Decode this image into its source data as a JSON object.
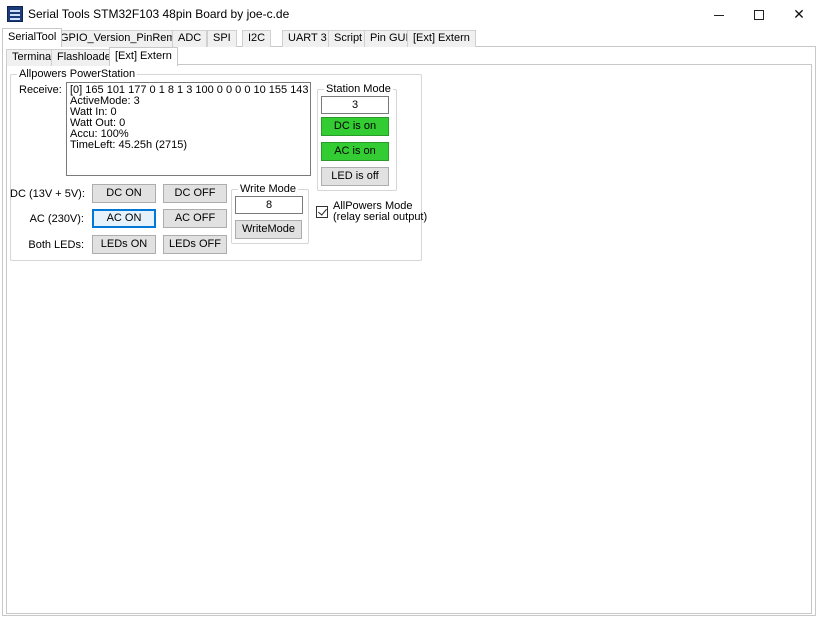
{
  "window": {
    "title": "Serial Tools STM32F103 48pin Board by joe-c.de",
    "controls": {
      "minimize": "",
      "maximize": "",
      "close": "✕"
    }
  },
  "top_tabs": [
    "SerialTool",
    "GPIO_Version_PinRemap",
    "ADC",
    "SPI",
    "I2C",
    "UART 3",
    "Script",
    "Pin GUI",
    "[Ext] Extern"
  ],
  "sub_tabs": [
    "Terminal",
    "Flashloader",
    "[Ext] Extern"
  ],
  "powerstation": {
    "group_title": "Allpowers PowerStation",
    "receive_label": "Receive:",
    "receive_lines": [
      "[0] 165 101 177 0 1 8 1 3 100 0 0 0 0 10 155 143",
      "ActiveMode: 3",
      "Watt In: 0",
      "Watt Out: 0",
      "Accu: 100%",
      "TimeLeft: 45.25h (2715)"
    ],
    "dc_label": "DC (13V + 5V):",
    "ac_label": "AC (230V):",
    "leds_label": "Both LEDs:",
    "dc_on": "DC ON",
    "dc_off": "DC OFF",
    "ac_on": "AC ON",
    "ac_off": "AC OFF",
    "leds_on": "LEDs ON",
    "leds_off": "LEDs OFF",
    "write_mode": {
      "title": "Write Mode",
      "value": "8",
      "button": "WriteMode"
    },
    "station_mode": {
      "title": "Station Mode",
      "value": "3",
      "dc_status": "DC is on",
      "ac_status": "AC is on",
      "led_status": "LED is off"
    },
    "allpowers_mode": {
      "label_line1": "AllPowers Mode",
      "label_line2": "(relay serial output)",
      "checked": true
    }
  },
  "colors": {
    "status_on": "#33cc33",
    "focus_border": "#0078d7"
  }
}
